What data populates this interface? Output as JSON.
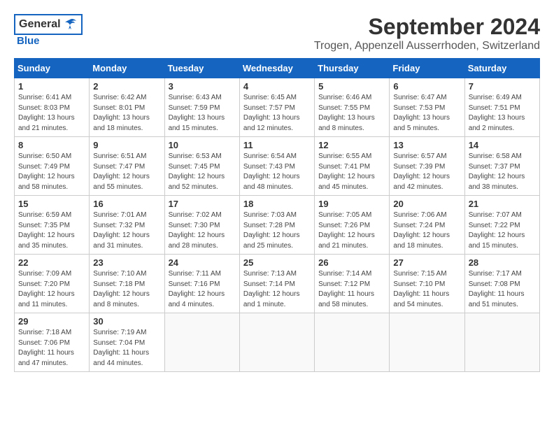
{
  "header": {
    "logo_general": "General",
    "logo_blue": "Blue",
    "month": "September 2024",
    "location": "Trogen, Appenzell Ausserrhoden, Switzerland"
  },
  "days_of_week": [
    "Sunday",
    "Monday",
    "Tuesday",
    "Wednesday",
    "Thursday",
    "Friday",
    "Saturday"
  ],
  "weeks": [
    [
      {
        "day": "1",
        "sunrise": "Sunrise: 6:41 AM",
        "sunset": "Sunset: 8:03 PM",
        "daylight": "Daylight: 13 hours and 21 minutes."
      },
      {
        "day": "2",
        "sunrise": "Sunrise: 6:42 AM",
        "sunset": "Sunset: 8:01 PM",
        "daylight": "Daylight: 13 hours and 18 minutes."
      },
      {
        "day": "3",
        "sunrise": "Sunrise: 6:43 AM",
        "sunset": "Sunset: 7:59 PM",
        "daylight": "Daylight: 13 hours and 15 minutes."
      },
      {
        "day": "4",
        "sunrise": "Sunrise: 6:45 AM",
        "sunset": "Sunset: 7:57 PM",
        "daylight": "Daylight: 13 hours and 12 minutes."
      },
      {
        "day": "5",
        "sunrise": "Sunrise: 6:46 AM",
        "sunset": "Sunset: 7:55 PM",
        "daylight": "Daylight: 13 hours and 8 minutes."
      },
      {
        "day": "6",
        "sunrise": "Sunrise: 6:47 AM",
        "sunset": "Sunset: 7:53 PM",
        "daylight": "Daylight: 13 hours and 5 minutes."
      },
      {
        "day": "7",
        "sunrise": "Sunrise: 6:49 AM",
        "sunset": "Sunset: 7:51 PM",
        "daylight": "Daylight: 13 hours and 2 minutes."
      }
    ],
    [
      {
        "day": "8",
        "sunrise": "Sunrise: 6:50 AM",
        "sunset": "Sunset: 7:49 PM",
        "daylight": "Daylight: 12 hours and 58 minutes."
      },
      {
        "day": "9",
        "sunrise": "Sunrise: 6:51 AM",
        "sunset": "Sunset: 7:47 PM",
        "daylight": "Daylight: 12 hours and 55 minutes."
      },
      {
        "day": "10",
        "sunrise": "Sunrise: 6:53 AM",
        "sunset": "Sunset: 7:45 PM",
        "daylight": "Daylight: 12 hours and 52 minutes."
      },
      {
        "day": "11",
        "sunrise": "Sunrise: 6:54 AM",
        "sunset": "Sunset: 7:43 PM",
        "daylight": "Daylight: 12 hours and 48 minutes."
      },
      {
        "day": "12",
        "sunrise": "Sunrise: 6:55 AM",
        "sunset": "Sunset: 7:41 PM",
        "daylight": "Daylight: 12 hours and 45 minutes."
      },
      {
        "day": "13",
        "sunrise": "Sunrise: 6:57 AM",
        "sunset": "Sunset: 7:39 PM",
        "daylight": "Daylight: 12 hours and 42 minutes."
      },
      {
        "day": "14",
        "sunrise": "Sunrise: 6:58 AM",
        "sunset": "Sunset: 7:37 PM",
        "daylight": "Daylight: 12 hours and 38 minutes."
      }
    ],
    [
      {
        "day": "15",
        "sunrise": "Sunrise: 6:59 AM",
        "sunset": "Sunset: 7:35 PM",
        "daylight": "Daylight: 12 hours and 35 minutes."
      },
      {
        "day": "16",
        "sunrise": "Sunrise: 7:01 AM",
        "sunset": "Sunset: 7:32 PM",
        "daylight": "Daylight: 12 hours and 31 minutes."
      },
      {
        "day": "17",
        "sunrise": "Sunrise: 7:02 AM",
        "sunset": "Sunset: 7:30 PM",
        "daylight": "Daylight: 12 hours and 28 minutes."
      },
      {
        "day": "18",
        "sunrise": "Sunrise: 7:03 AM",
        "sunset": "Sunset: 7:28 PM",
        "daylight": "Daylight: 12 hours and 25 minutes."
      },
      {
        "day": "19",
        "sunrise": "Sunrise: 7:05 AM",
        "sunset": "Sunset: 7:26 PM",
        "daylight": "Daylight: 12 hours and 21 minutes."
      },
      {
        "day": "20",
        "sunrise": "Sunrise: 7:06 AM",
        "sunset": "Sunset: 7:24 PM",
        "daylight": "Daylight: 12 hours and 18 minutes."
      },
      {
        "day": "21",
        "sunrise": "Sunrise: 7:07 AM",
        "sunset": "Sunset: 7:22 PM",
        "daylight": "Daylight: 12 hours and 15 minutes."
      }
    ],
    [
      {
        "day": "22",
        "sunrise": "Sunrise: 7:09 AM",
        "sunset": "Sunset: 7:20 PM",
        "daylight": "Daylight: 12 hours and 11 minutes."
      },
      {
        "day": "23",
        "sunrise": "Sunrise: 7:10 AM",
        "sunset": "Sunset: 7:18 PM",
        "daylight": "Daylight: 12 hours and 8 minutes."
      },
      {
        "day": "24",
        "sunrise": "Sunrise: 7:11 AM",
        "sunset": "Sunset: 7:16 PM",
        "daylight": "Daylight: 12 hours and 4 minutes."
      },
      {
        "day": "25",
        "sunrise": "Sunrise: 7:13 AM",
        "sunset": "Sunset: 7:14 PM",
        "daylight": "Daylight: 12 hours and 1 minute."
      },
      {
        "day": "26",
        "sunrise": "Sunrise: 7:14 AM",
        "sunset": "Sunset: 7:12 PM",
        "daylight": "Daylight: 11 hours and 58 minutes."
      },
      {
        "day": "27",
        "sunrise": "Sunrise: 7:15 AM",
        "sunset": "Sunset: 7:10 PM",
        "daylight": "Daylight: 11 hours and 54 minutes."
      },
      {
        "day": "28",
        "sunrise": "Sunrise: 7:17 AM",
        "sunset": "Sunset: 7:08 PM",
        "daylight": "Daylight: 11 hours and 51 minutes."
      }
    ],
    [
      {
        "day": "29",
        "sunrise": "Sunrise: 7:18 AM",
        "sunset": "Sunset: 7:06 PM",
        "daylight": "Daylight: 11 hours and 47 minutes."
      },
      {
        "day": "30",
        "sunrise": "Sunrise: 7:19 AM",
        "sunset": "Sunset: 7:04 PM",
        "daylight": "Daylight: 11 hours and 44 minutes."
      },
      {
        "day": "",
        "sunrise": "",
        "sunset": "",
        "daylight": ""
      },
      {
        "day": "",
        "sunrise": "",
        "sunset": "",
        "daylight": ""
      },
      {
        "day": "",
        "sunrise": "",
        "sunset": "",
        "daylight": ""
      },
      {
        "day": "",
        "sunrise": "",
        "sunset": "",
        "daylight": ""
      },
      {
        "day": "",
        "sunrise": "",
        "sunset": "",
        "daylight": ""
      }
    ]
  ]
}
